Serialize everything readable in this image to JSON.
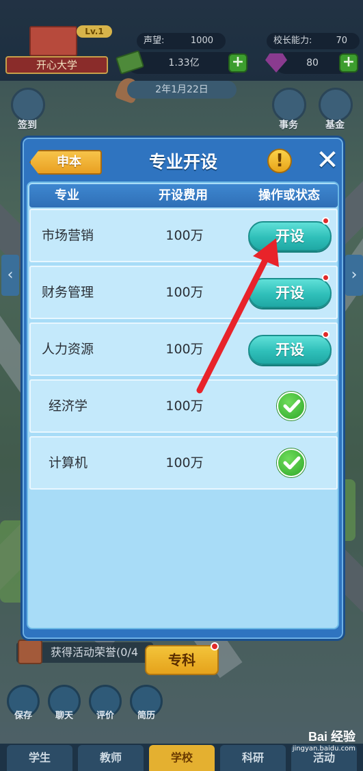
{
  "top_bar": {
    "school_name": "开心大学",
    "level": "Lv.1",
    "reputation_label": "声望:",
    "reputation_value": "1000",
    "principal_label": "校长能力:",
    "principal_value": "70",
    "money": "1.33亿",
    "gems": "80",
    "date": "2年1月22日"
  },
  "side_buttons": {
    "checkin": "签到",
    "affairs": "事务",
    "fund": "基金"
  },
  "modal": {
    "back_label": "申本",
    "title": "专业开设",
    "info_glyph": "!",
    "close_glyph": "✕",
    "columns": [
      "专业",
      "开设费用",
      "操作或状态"
    ],
    "rows": [
      {
        "name": "市场营销",
        "cost": "100万",
        "status": "button",
        "button_label": "开设"
      },
      {
        "name": "财务管理",
        "cost": "100万",
        "status": "button",
        "button_label": "开设"
      },
      {
        "name": "人力资源",
        "cost": "100万",
        "status": "button",
        "button_label": "开设"
      },
      {
        "name": "经济学",
        "cost": "100万",
        "status": "done"
      },
      {
        "name": "计算机",
        "cost": "100万",
        "status": "done"
      }
    ]
  },
  "bottom": {
    "activity_text": "获得活动荣誉(0/4",
    "zhuanke_label": "专科",
    "tools": [
      "保存",
      "聊天",
      "评价",
      "简历"
    ],
    "nav": [
      "学生",
      "教师",
      "学校",
      "科研",
      "活动"
    ],
    "active_nav": "学校"
  },
  "watermark": {
    "logo": "Bai 经验",
    "url": "jingyan.baidu.com"
  },
  "colors": {
    "modal_blue": "#2f74c0",
    "body_blue": "#a8dcf7",
    "open_teal": "#2fbfb9",
    "check_green": "#2fa82a",
    "arrow_red": "#e8232a"
  }
}
